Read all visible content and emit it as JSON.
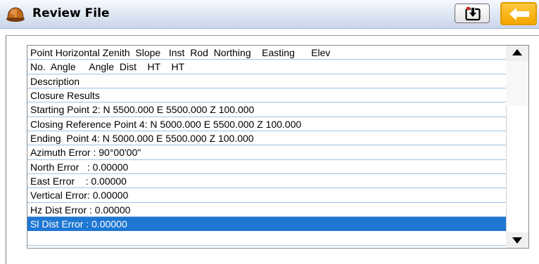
{
  "window": {
    "title": "Review File",
    "app_icon": "hardhat-icon",
    "save_icon": "download-tray-icon",
    "back_icon": "arrow-left-icon",
    "accent_color": "#f5a500",
    "selection_color": "#1e77d3"
  },
  "list": {
    "rows": [
      "Point Horizontal Zenith  Slope   Inst  Rod  Northing    Easting      Elev",
      "No.  Angle     Angle  Dist    HT    HT",
      "Description",
      "Closure Results",
      "Starting Point 2: N 5500.000 E 5500.000 Z 100.000",
      "Closing Reference Point 4: N 5000.000 E 5500.000 Z 100.000",
      "Ending  Point 4: N 5000.000 E 5500.000 Z 100.000",
      "Azimuth Error : 90°00'00\"",
      "North Error   : 0.00000",
      "East Error    : 0.00000",
      "Vertical Error: 0.00000",
      "Hz Dist Error : 0.00000",
      "Sl Dist Error : 0.00000",
      ""
    ],
    "selected_index": 12
  }
}
